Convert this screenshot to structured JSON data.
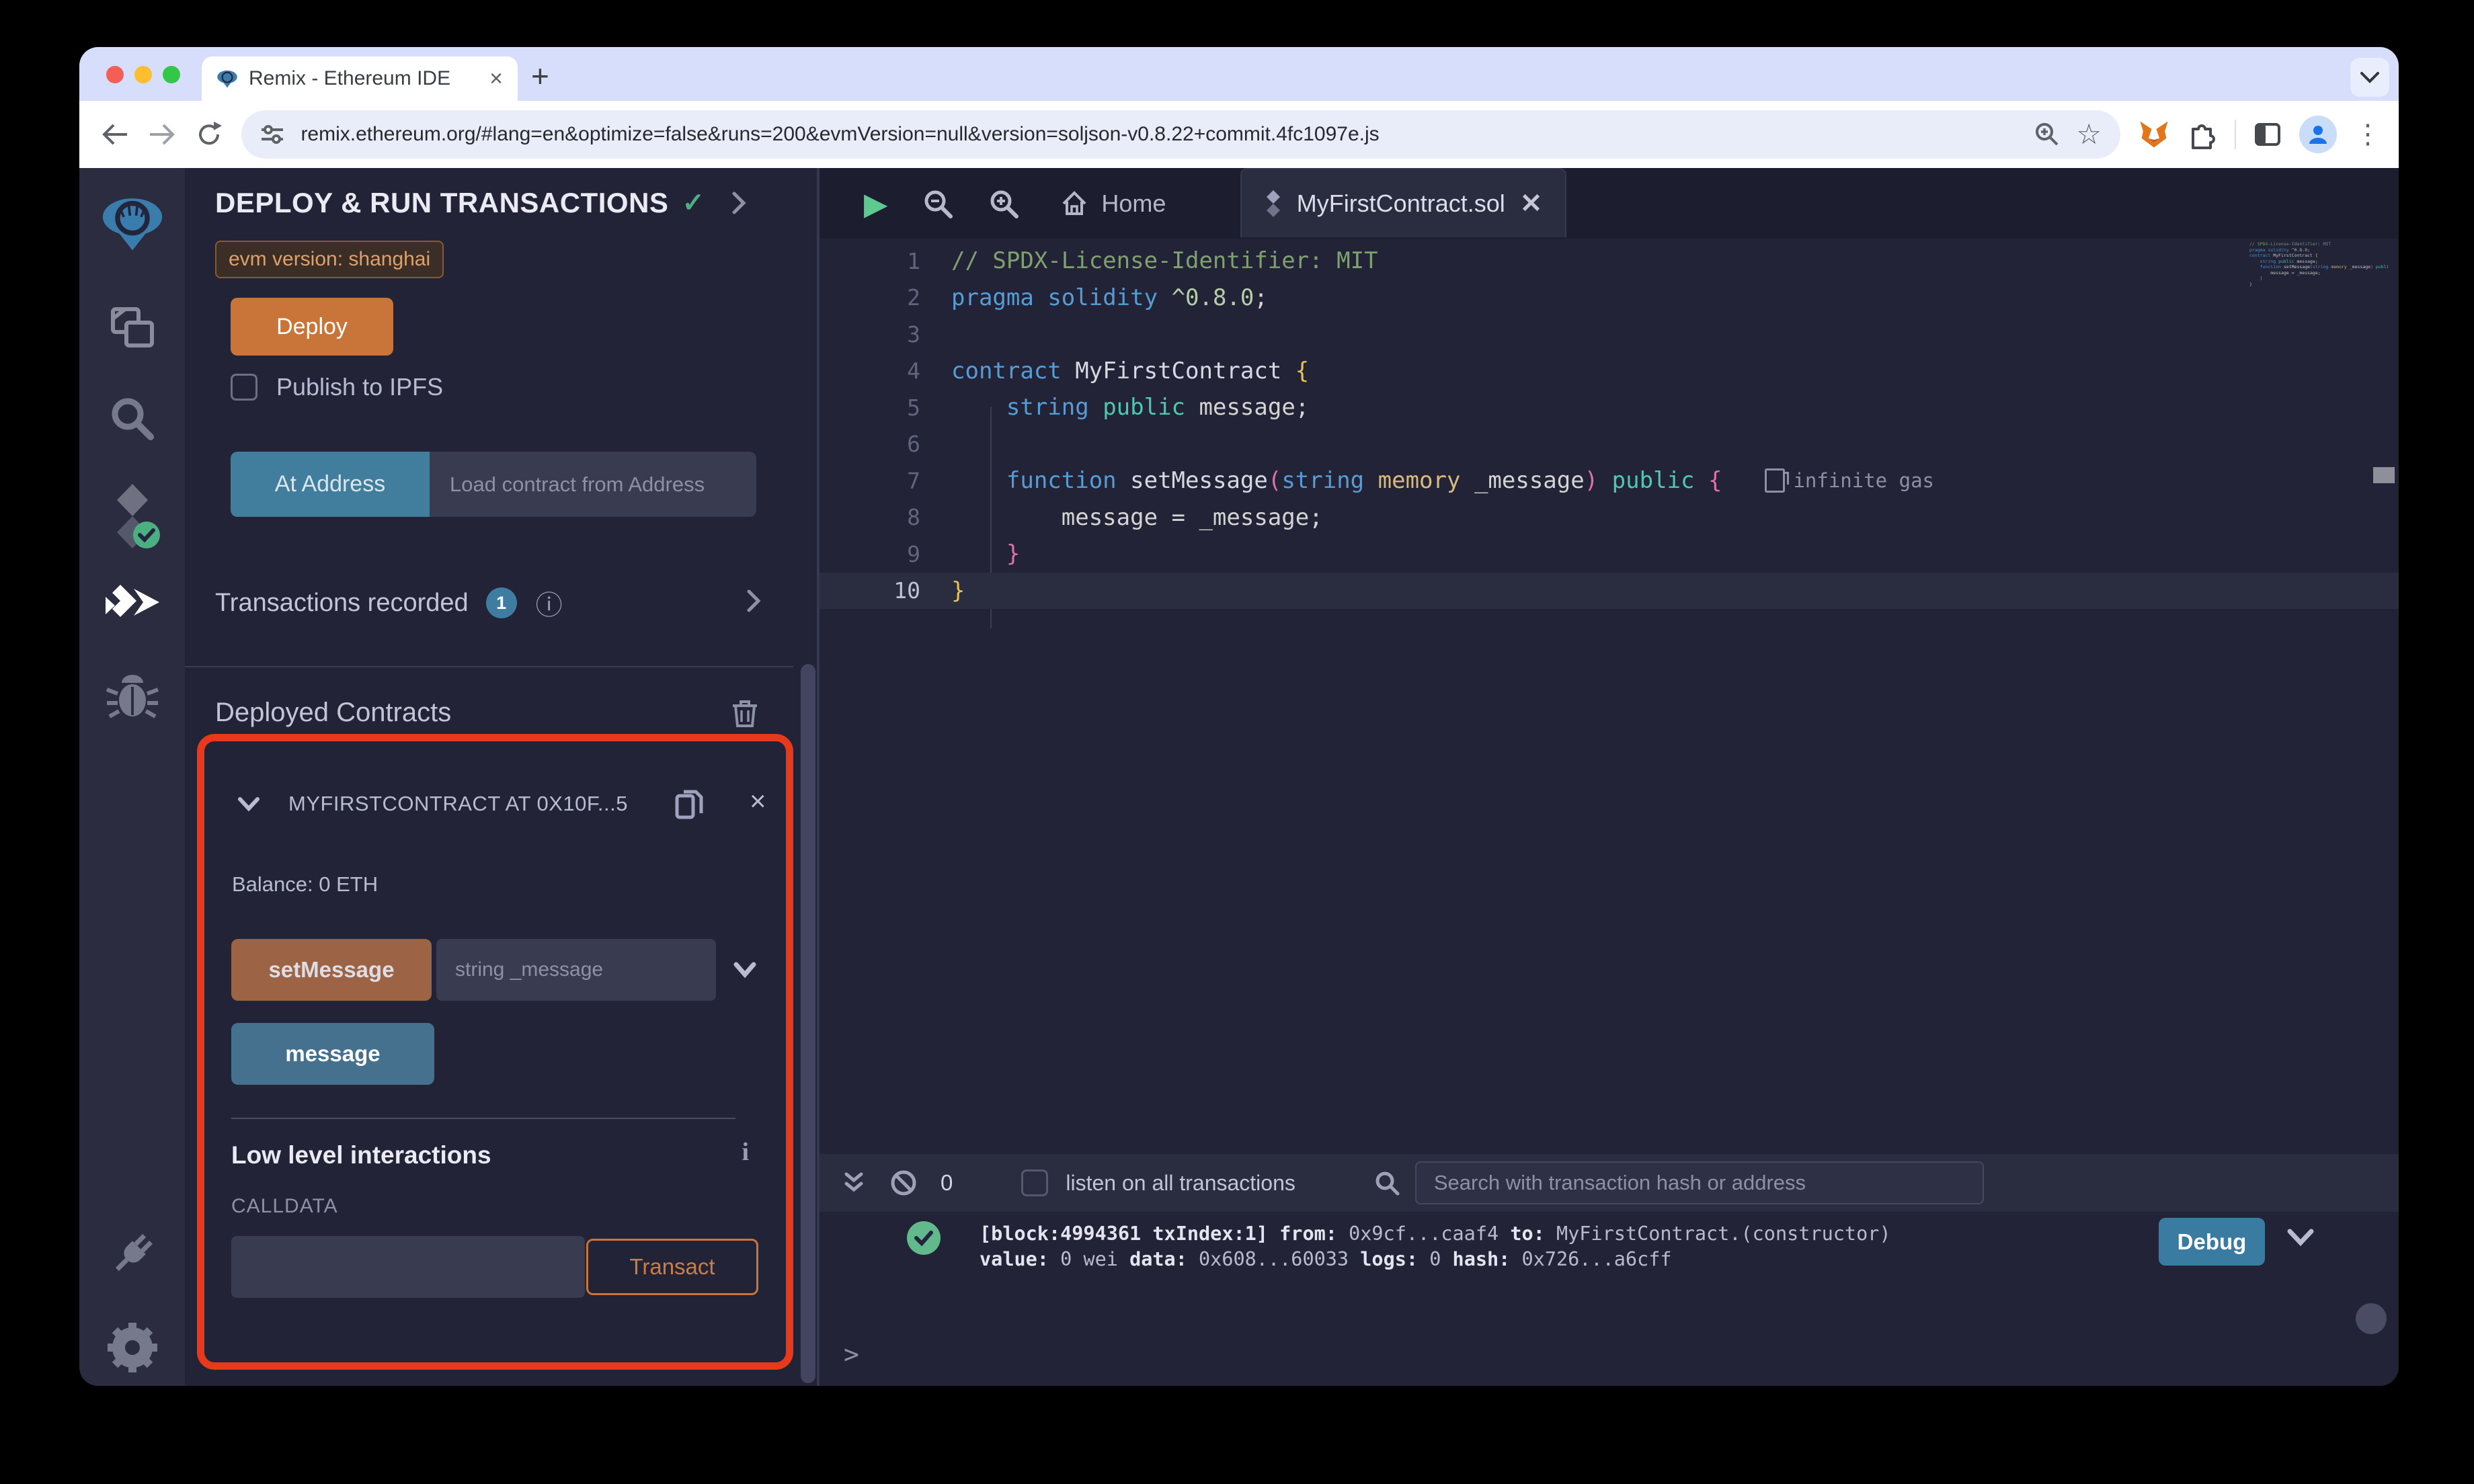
{
  "browser": {
    "tab_title": "Remix - Ethereum IDE",
    "tab_close": "×",
    "new_tab": "+",
    "url": "remix.ethereum.org/#lang=en&optimize=false&runs=200&evmVersion=null&version=soljson-v0.8.22+commit.4fc1097e.js",
    "kebab": "⋮",
    "star": "☆",
    "icons": [
      "back-arrow",
      "forward-arrow",
      "reload",
      "tune",
      "zoom",
      "bookmark-star",
      "metamask-fox",
      "extensions-puzzle",
      "side-panel",
      "profile-avatar",
      "menu-kebab"
    ]
  },
  "icon_panel": {
    "items": [
      "remix-logo",
      "file-explorer",
      "search",
      "solidity-compiler",
      "deploy-and-run",
      "debugger",
      "plugin-manager",
      "settings"
    ]
  },
  "side_panel": {
    "title": "DEPLOY & RUN TRANSACTIONS",
    "check": "✓",
    "evm_badge": "evm version: shanghai",
    "deploy_label": "Deploy",
    "publish_label": "Publish to IPFS",
    "at_address_label": "At Address",
    "at_address_placeholder": "Load contract from Address",
    "transactions_label": "Transactions recorded",
    "transactions_count": "1",
    "deployed_label": "Deployed Contracts",
    "contract": {
      "title": "MYFIRSTCONTRACT AT 0X10F...5",
      "close": "×",
      "balance": "Balance: 0 ETH",
      "set_message_label": "setMessage",
      "set_message_placeholder": "string _message",
      "message_label": "message",
      "low_level_label": "Low level interactions",
      "low_level_info": "i",
      "calldata_label": "CALLDATA",
      "transact_label": "Transact"
    }
  },
  "editor": {
    "play": "▶",
    "tabs": [
      {
        "label": "Home"
      },
      {
        "label": "MyFirstContract.sol",
        "close": "✕"
      }
    ],
    "gas_annotation": "infinite gas",
    "active_line": 10,
    "lines": [
      {
        "n": 1,
        "tokens": [
          [
            "// SPDX-License-Identifier: MIT",
            "cm"
          ]
        ]
      },
      {
        "n": 2,
        "tokens": [
          [
            "pragma",
            "kw"
          ],
          [
            " ",
            "pl"
          ],
          [
            "solidity",
            "kw"
          ],
          [
            " ",
            "pl"
          ],
          [
            "^0.8.0",
            "num"
          ],
          [
            ";",
            "pl"
          ]
        ]
      },
      {
        "n": 3,
        "tokens": []
      },
      {
        "n": 4,
        "tokens": [
          [
            "contract",
            "kw"
          ],
          [
            " ",
            "pl"
          ],
          [
            "MyFirstContract",
            "fn"
          ],
          [
            " ",
            "pl"
          ],
          [
            "{",
            "yb"
          ]
        ]
      },
      {
        "n": 5,
        "tokens": [
          [
            "    ",
            "pl"
          ],
          [
            "string",
            "kw"
          ],
          [
            " ",
            "pl"
          ],
          [
            "public",
            "pub"
          ],
          [
            " ",
            "pl"
          ],
          [
            "message;",
            "pl"
          ]
        ]
      },
      {
        "n": 6,
        "tokens": []
      },
      {
        "n": 7,
        "gas": true,
        "tokens": [
          [
            "    ",
            "pl"
          ],
          [
            "function",
            "kw"
          ],
          [
            " ",
            "pl"
          ],
          [
            "setMessage",
            "fn"
          ],
          [
            "(",
            "pb"
          ],
          [
            "string",
            "kw"
          ],
          [
            " ",
            "pl"
          ],
          [
            "memory",
            "mem"
          ],
          [
            " _message",
            "pl"
          ],
          [
            ")",
            "pb"
          ],
          [
            " ",
            "pl"
          ],
          [
            "public",
            "pub"
          ],
          [
            " ",
            "pl"
          ],
          [
            "{",
            "pb"
          ]
        ]
      },
      {
        "n": 8,
        "tokens": [
          [
            "        message = _message;",
            "pl"
          ]
        ]
      },
      {
        "n": 9,
        "tokens": [
          [
            "    ",
            "pl"
          ],
          [
            "}",
            "pb"
          ]
        ]
      },
      {
        "n": 10,
        "tokens": [
          [
            "}",
            "yb"
          ]
        ]
      }
    ]
  },
  "terminal": {
    "count": "0",
    "listen_label": "listen on all transactions",
    "search_placeholder": "Search with transaction hash or address",
    "log_check": "✓",
    "log_line1": [
      [
        "[block:4994361 txIndex:1] ",
        "b"
      ],
      [
        "from:",
        "b"
      ],
      [
        " 0x9cf...caaf4 ",
        "n"
      ],
      [
        "to:",
        "b"
      ],
      [
        " MyFirstContract.(constructor) ",
        "n"
      ]
    ],
    "log_line2": [
      [
        "value:",
        "b"
      ],
      [
        " 0 wei ",
        "n"
      ],
      [
        "data:",
        "b"
      ],
      [
        " 0x608...60033 ",
        "n"
      ],
      [
        "logs:",
        "b"
      ],
      [
        " 0 ",
        "n"
      ],
      [
        "hash:",
        "b"
      ],
      [
        " 0x726...a6cff",
        "n"
      ]
    ],
    "debug_label": "Debug",
    "prompt": ">"
  },
  "colors": {
    "accent_orange": "#c97539",
    "accent_teal": "#417e9d",
    "highlight_red": "#e8391d",
    "success_green": "#62ba8c",
    "badge_blue": "#3e7ca2",
    "panel_bg": "#222336",
    "icon_panel_bg": "#2b2c3f"
  }
}
